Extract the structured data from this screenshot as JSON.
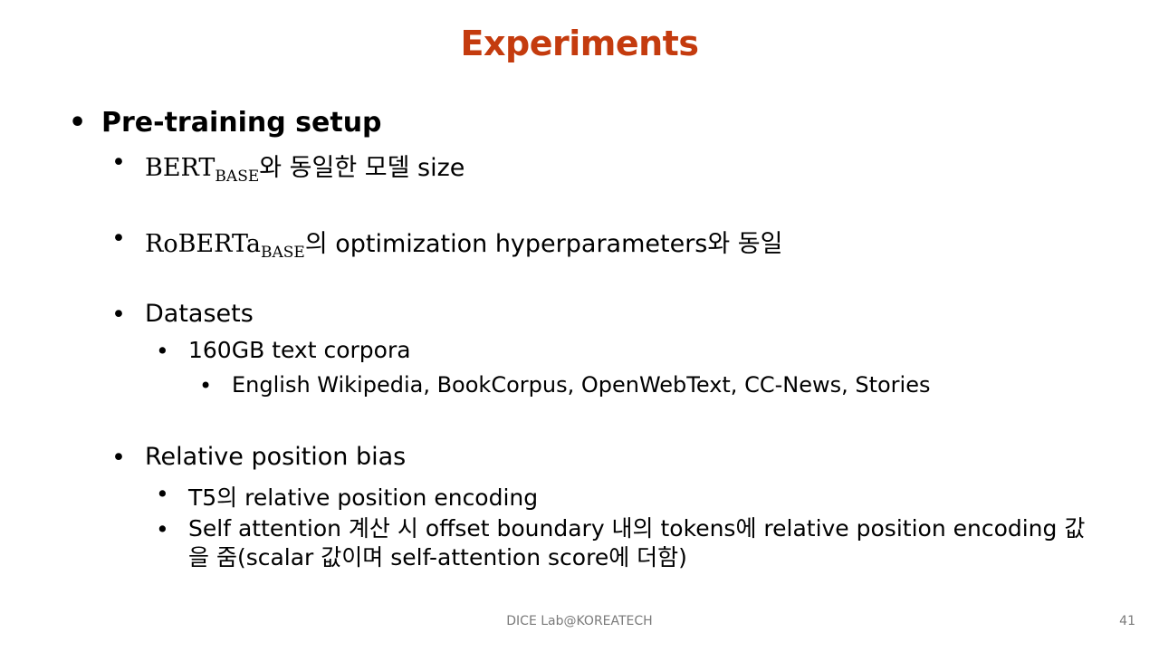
{
  "slide": {
    "title": "Experiments",
    "bullet_glyph": "•",
    "pretraining_heading": "Pre-training setup",
    "bert": {
      "main": "BERT",
      "sub": "BASE",
      "tail": "와 동일한 모델 size"
    },
    "roberta": {
      "main": "RoBERTa",
      "sub": "BASE",
      "tail": "의 optimization hyperparameters와 동일"
    },
    "datasets": "Datasets",
    "corpus_size": "160GB text corpora",
    "corpus_list": "English Wikipedia, BookCorpus, OpenWebText, CC-News, Stories",
    "relpos": "Relative position bias",
    "t5": "T5의 relative position encoding",
    "selfattn": "Self attention 계산 시 offset boundary 내의 tokens에 relative position encoding 값을 줌(scalar 값이며 self-attention score에 더함)"
  },
  "footer": {
    "lab": "DICE Lab@KOREATECH",
    "page_number": "41"
  },
  "colors": {
    "title": "#c43b0e",
    "text": "#000000",
    "footer": "#7a7a7a"
  }
}
